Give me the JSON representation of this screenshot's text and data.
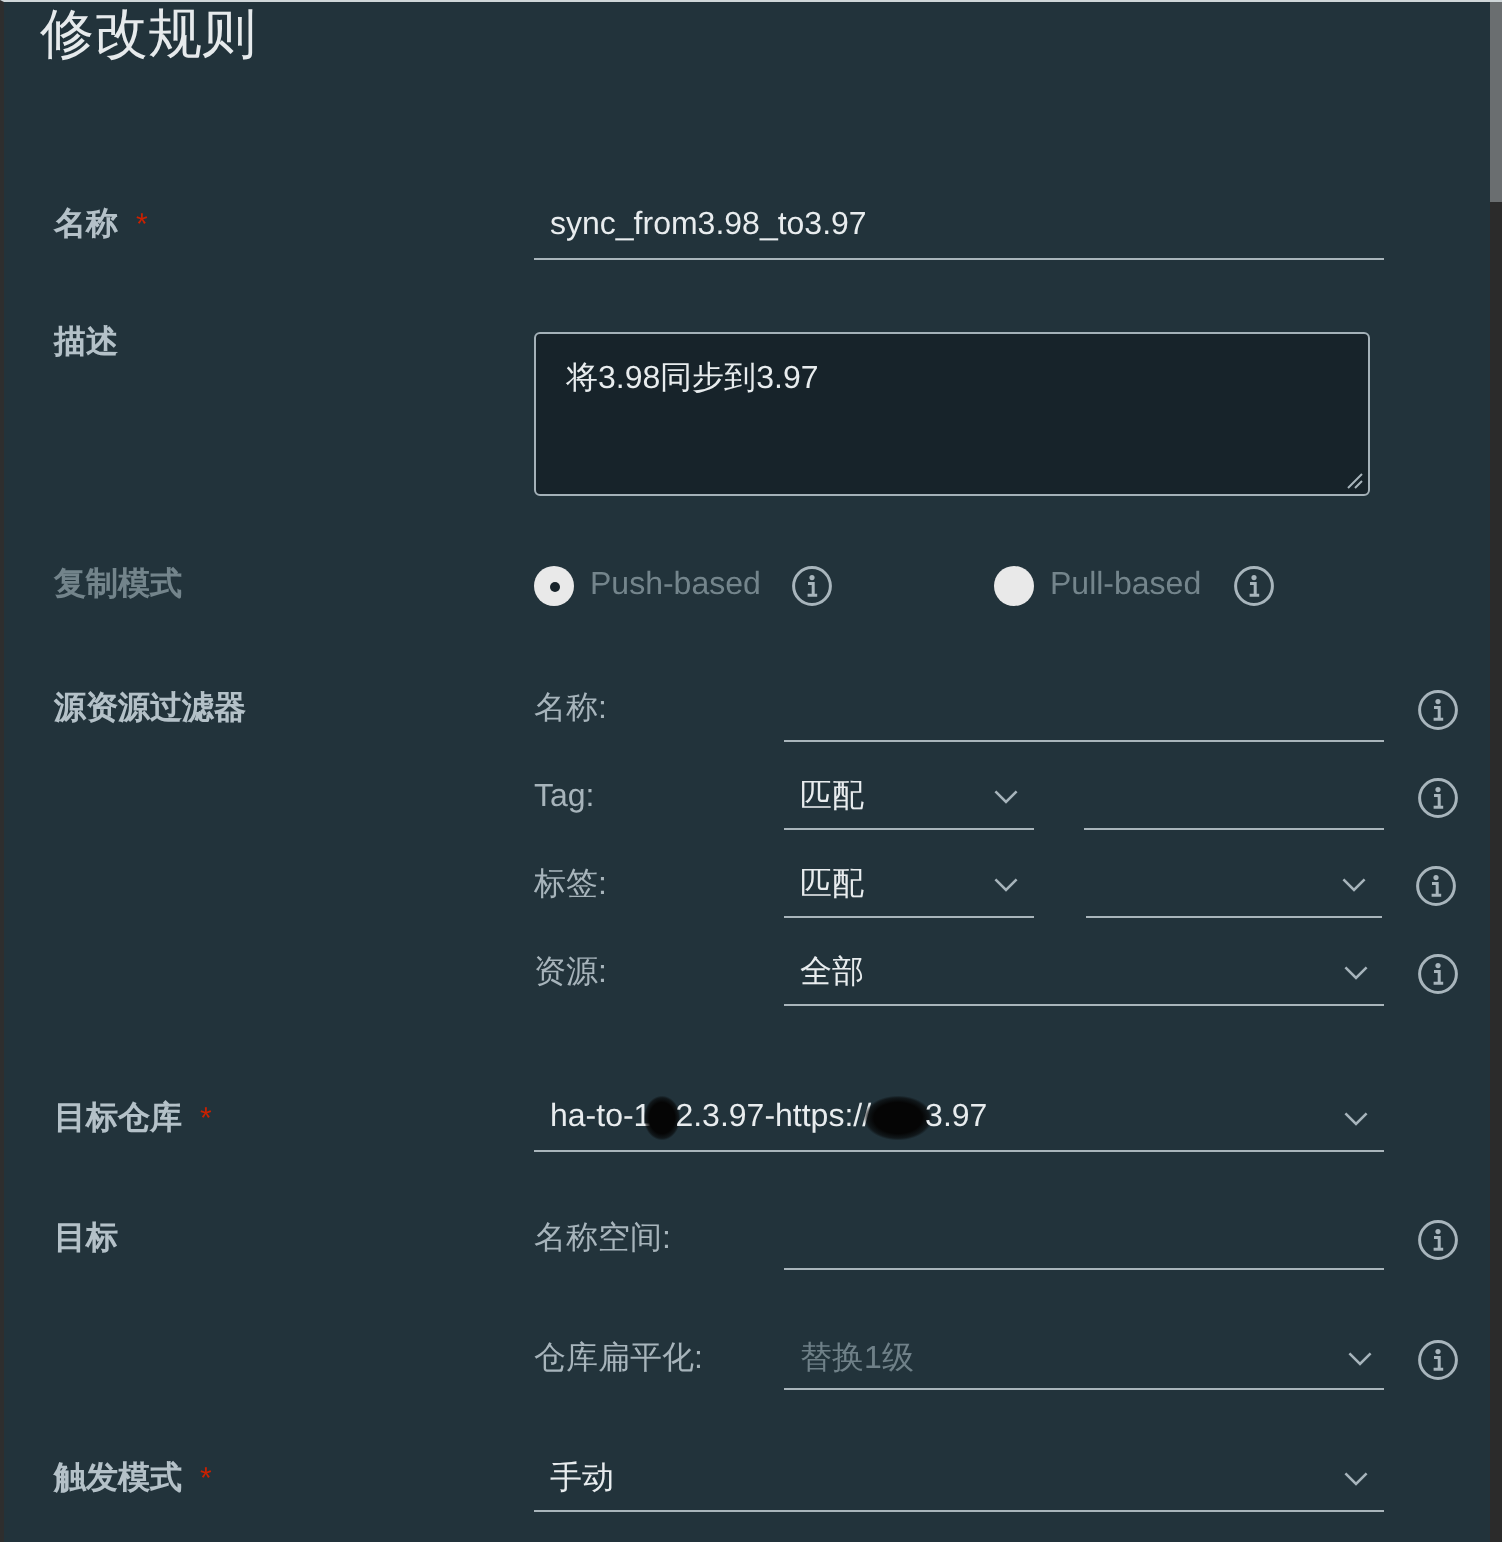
{
  "title": "修改规则",
  "form": {
    "name": {
      "label": "名称",
      "required_mark": "*",
      "value": "sync_from3.98_to3.97"
    },
    "description": {
      "label": "描述",
      "value": "将3.98同步到3.97"
    },
    "replication_mode": {
      "label": "复制模式",
      "disabled": true,
      "options": [
        {
          "label": "Push-based",
          "selected": true
        },
        {
          "label": "Pull-based",
          "selected": false
        }
      ]
    },
    "source_filter": {
      "label": "源资源过滤器",
      "rows": [
        {
          "kind": "input",
          "label": "名称:",
          "disabled": false
        },
        {
          "kind": "match-input",
          "label": "Tag:",
          "match": "匹配",
          "disabled": false
        },
        {
          "kind": "match-select",
          "label": "标签:",
          "match": "匹配",
          "disabled": false
        },
        {
          "kind": "select",
          "label": "资源:",
          "value": "全部",
          "disabled": false
        }
      ]
    },
    "destination_registry": {
      "label": "目标仓库",
      "required_mark": "*",
      "value_parts": [
        "ha-to-1",
        "2.3.97-https://",
        "3.97"
      ]
    },
    "destination": {
      "label": "目标",
      "rows": [
        {
          "kind": "input",
          "label": "名称空间:",
          "disabled": false
        },
        {
          "kind": "select",
          "label": "仓库扁平化:",
          "value": "替换1级",
          "disabled": true
        }
      ]
    },
    "trigger_mode": {
      "label": "触发模式",
      "required_mark": "*",
      "value": "手动"
    }
  }
}
